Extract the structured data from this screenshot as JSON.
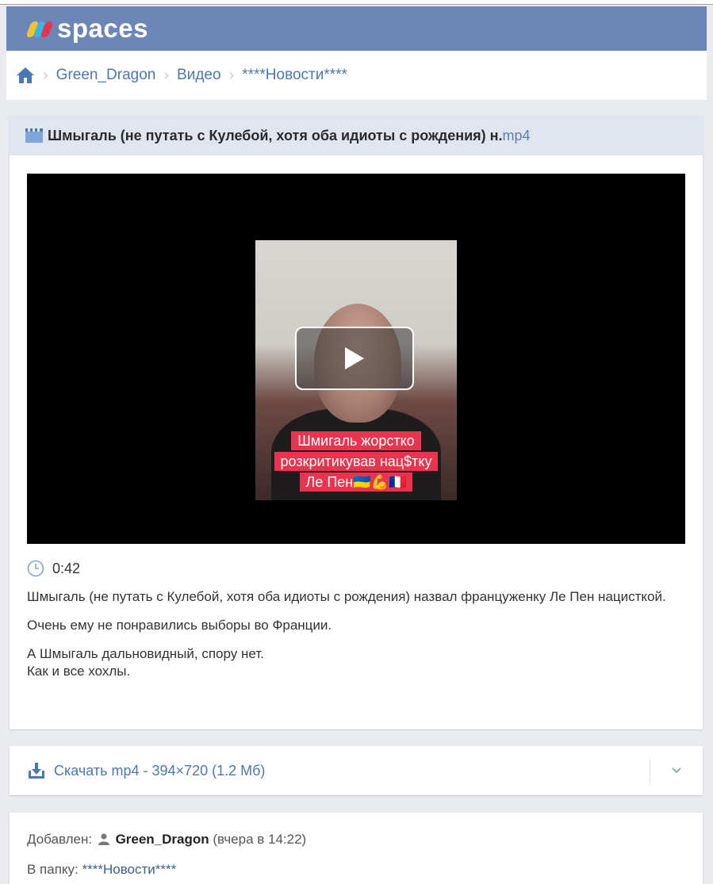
{
  "header": {
    "logo_text": "spaces",
    "logo_colors": [
      "#f4c430",
      "#38b6e8",
      "#e8344e"
    ]
  },
  "breadcrumb": {
    "items": [
      "Green_Dragon",
      "Видео",
      "****Новости****"
    ],
    "separator": ">"
  },
  "video": {
    "title_main": "Шмыгаль (не путать с Кулебой, хотя оба идиоты с рождения) н.",
    "title_ext": "mp4",
    "thumbnail_caption": [
      "Шмигаль жорстко",
      "розкритикував нац$тку",
      "Ле Пен🇺🇦💪🇫🇷"
    ],
    "duration": "0:42",
    "description": [
      "Шмыгаль (не путать с Кулебой, хотя оба идиоты с рождения) назвал француженку Ле Пен нацисткой.",
      "Очень ему не понравились выборы во Франции.",
      "А Шмыгаль дальновидный, спору нет.",
      "Как и все хохлы."
    ]
  },
  "download": {
    "label": "Скачать mp4 - 394×720 (1.2 Мб)"
  },
  "info": {
    "added_label": "Добавлен:",
    "added_user": "Green_Dragon",
    "added_time": "(вчера в 14:22)",
    "folder_label": "В папку:",
    "folder_name": "****Новости****"
  },
  "colors": {
    "header_bg": "#6d86b8",
    "title_bar_bg": "#dfe6f0",
    "link": "#4a78b4",
    "caption_bg": "#e8344e"
  }
}
